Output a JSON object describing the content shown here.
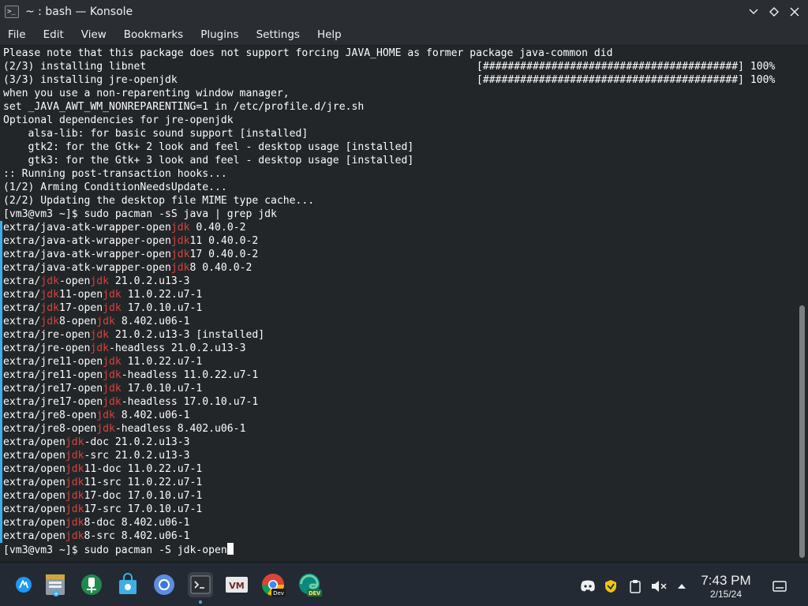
{
  "window": {
    "title": "~ : bash — Konsole",
    "app_icon_glyph": ">_"
  },
  "menu": [
    "File",
    "Edit",
    "View",
    "Bookmarks",
    "Plugins",
    "Settings",
    "Help"
  ],
  "terminal": {
    "lines": [
      [
        {
          "t": "Please note that this package does not support forcing JAVA_HOME as former package java-common did"
        }
      ],
      [
        {
          "t": "(2/3) installing libnet"
        }
      ],
      [
        {
          "t": "(3/3) installing jre-openjdk"
        }
      ],
      [
        {
          "t": "when you use a non-reparenting window manager,"
        }
      ],
      [
        {
          "t": "set _JAVA_AWT_WM_NONREPARENTING=1 in /etc/profile.d/jre.sh"
        }
      ],
      [
        {
          "t": "Optional dependencies for jre-openjdk"
        }
      ],
      [
        {
          "t": "    alsa-lib: for basic sound support [installed]"
        }
      ],
      [
        {
          "t": "    gtk2: for the Gtk+ 2 look and feel - desktop usage [installed]"
        }
      ],
      [
        {
          "t": "    gtk3: for the Gtk+ 3 look and feel - desktop usage [installed]"
        }
      ],
      [
        {
          "t": ":: Running post-transaction hooks..."
        }
      ],
      [
        {
          "t": "(1/2) Arming ConditionNeedsUpdate..."
        }
      ],
      [
        {
          "t": "(2/2) Updating the desktop file MIME type cache..."
        }
      ],
      [
        {
          "t": "[vm3@vm3 ~]$ sudo pacman -sS java | grep jdk"
        }
      ],
      [
        {
          "t": "extra/java-atk-wrapper-open"
        },
        {
          "t": "jdk",
          "h": true
        },
        {
          "t": " 0.40.0-2"
        }
      ],
      [
        {
          "t": "extra/java-atk-wrapper-open"
        },
        {
          "t": "jdk",
          "h": true
        },
        {
          "t": "11 0.40.0-2"
        }
      ],
      [
        {
          "t": "extra/java-atk-wrapper-open"
        },
        {
          "t": "jdk",
          "h": true
        },
        {
          "t": "17 0.40.0-2"
        }
      ],
      [
        {
          "t": "extra/java-atk-wrapper-open"
        },
        {
          "t": "jdk",
          "h": true
        },
        {
          "t": "8 0.40.0-2"
        }
      ],
      [
        {
          "t": "extra/"
        },
        {
          "t": "jdk",
          "h": true
        },
        {
          "t": "-open"
        },
        {
          "t": "jdk",
          "h": true
        },
        {
          "t": " 21.0.2.u13-3"
        }
      ],
      [
        {
          "t": "extra/"
        },
        {
          "t": "jdk",
          "h": true
        },
        {
          "t": "11-open"
        },
        {
          "t": "jdk",
          "h": true
        },
        {
          "t": " 11.0.22.u7-1"
        }
      ],
      [
        {
          "t": "extra/"
        },
        {
          "t": "jdk",
          "h": true
        },
        {
          "t": "17-open"
        },
        {
          "t": "jdk",
          "h": true
        },
        {
          "t": " 17.0.10.u7-1"
        }
      ],
      [
        {
          "t": "extra/"
        },
        {
          "t": "jdk",
          "h": true
        },
        {
          "t": "8-open"
        },
        {
          "t": "jdk",
          "h": true
        },
        {
          "t": " 8.402.u06-1"
        }
      ],
      [
        {
          "t": "extra/jre-open"
        },
        {
          "t": "jdk",
          "h": true
        },
        {
          "t": " 21.0.2.u13-3 [installed]"
        }
      ],
      [
        {
          "t": "extra/jre-open"
        },
        {
          "t": "jdk",
          "h": true
        },
        {
          "t": "-headless 21.0.2.u13-3"
        }
      ],
      [
        {
          "t": "extra/jre11-open"
        },
        {
          "t": "jdk",
          "h": true
        },
        {
          "t": " 11.0.22.u7-1"
        }
      ],
      [
        {
          "t": "extra/jre11-open"
        },
        {
          "t": "jdk",
          "h": true
        },
        {
          "t": "-headless 11.0.22.u7-1"
        }
      ],
      [
        {
          "t": "extra/jre17-open"
        },
        {
          "t": "jdk",
          "h": true
        },
        {
          "t": " 17.0.10.u7-1"
        }
      ],
      [
        {
          "t": "extra/jre17-open"
        },
        {
          "t": "jdk",
          "h": true
        },
        {
          "t": "-headless 17.0.10.u7-1"
        }
      ],
      [
        {
          "t": "extra/jre8-open"
        },
        {
          "t": "jdk",
          "h": true
        },
        {
          "t": " 8.402.u06-1"
        }
      ],
      [
        {
          "t": "extra/jre8-open"
        },
        {
          "t": "jdk",
          "h": true
        },
        {
          "t": "-headless 8.402.u06-1"
        }
      ],
      [
        {
          "t": "extra/open"
        },
        {
          "t": "jdk",
          "h": true
        },
        {
          "t": "-doc 21.0.2.u13-3"
        }
      ],
      [
        {
          "t": "extra/open"
        },
        {
          "t": "jdk",
          "h": true
        },
        {
          "t": "-src 21.0.2.u13-3"
        }
      ],
      [
        {
          "t": "extra/open"
        },
        {
          "t": "jdk",
          "h": true
        },
        {
          "t": "11-doc 11.0.22.u7-1"
        }
      ],
      [
        {
          "t": "extra/open"
        },
        {
          "t": "jdk",
          "h": true
        },
        {
          "t": "11-src 11.0.22.u7-1"
        }
      ],
      [
        {
          "t": "extra/open"
        },
        {
          "t": "jdk",
          "h": true
        },
        {
          "t": "17-doc 17.0.10.u7-1"
        }
      ],
      [
        {
          "t": "extra/open"
        },
        {
          "t": "jdk",
          "h": true
        },
        {
          "t": "17-src 17.0.10.u7-1"
        }
      ],
      [
        {
          "t": "extra/open"
        },
        {
          "t": "jdk",
          "h": true
        },
        {
          "t": "8-doc 8.402.u06-1"
        }
      ],
      [
        {
          "t": "extra/open"
        },
        {
          "t": "jdk",
          "h": true
        },
        {
          "t": "8-src 8.402.u06-1"
        }
      ],
      [
        {
          "t": "[vm3@vm3 ~]$ sudo pacman -S jdk-open"
        }
      ]
    ],
    "progress_rows": [
      {
        "line": 1,
        "bar": "[#########################################]",
        "percent": "100%"
      },
      {
        "line": 2,
        "bar": "[#########################################]",
        "percent": "100%"
      }
    ],
    "output_marker_ranges": [
      [
        13,
        36
      ]
    ],
    "cursor_line": 37,
    "highlight_color": "#d7423c",
    "scroll_position": 1.0
  },
  "taskbar": {
    "launchers": [
      {
        "name": "application-launcher",
        "icon": "kde-logo-icon"
      },
      {
        "name": "discover",
        "icon": "discover-store-icon"
      },
      {
        "name": "kdeconnect",
        "icon": "kdeconnect-icon"
      },
      {
        "name": "software-center",
        "icon": "shopping-bag-icon"
      },
      {
        "name": "chromium",
        "icon": "chromium-icon"
      },
      {
        "name": "konsole",
        "icon": "terminal-icon",
        "active": true
      },
      {
        "name": "vmware",
        "icon": "vmware-icon",
        "label": "VM"
      },
      {
        "name": "chrome-dev",
        "icon": "chrome-dev-icon",
        "badge": "Dev"
      },
      {
        "name": "edge-dev",
        "icon": "edge-dev-icon",
        "badge": "DEV"
      }
    ],
    "tray": [
      "discord-icon",
      "shield-icon",
      "clipboard-icon",
      "volume-muted-icon",
      "expand-tray-icon"
    ],
    "clock": {
      "time": "7:43 PM",
      "date": "2/15/24"
    },
    "show_desktop_icon": "show-desktop-icon"
  }
}
